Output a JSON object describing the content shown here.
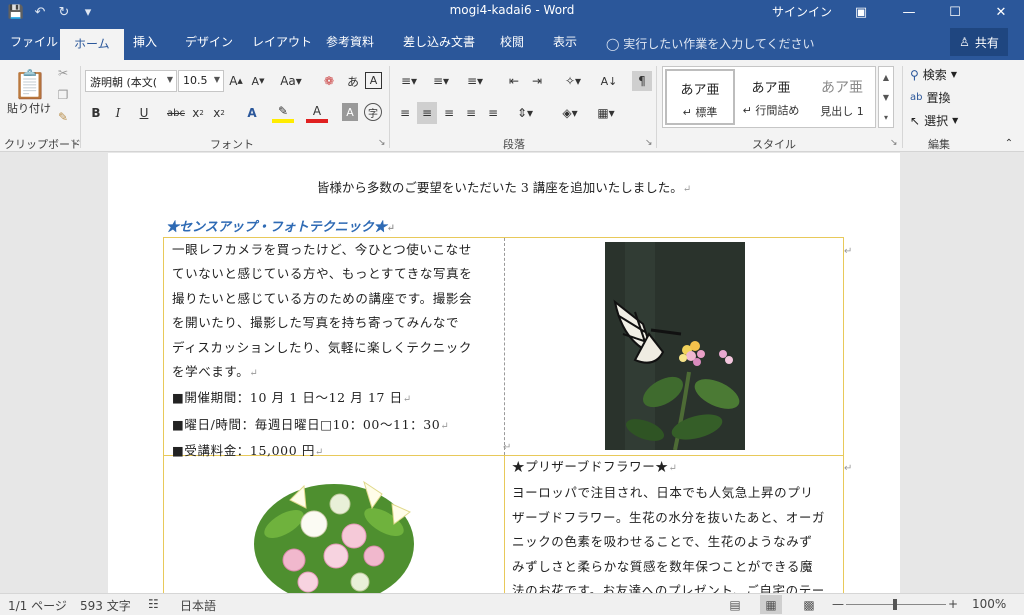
{
  "titlebar": {
    "title": "mogi4-kadai6  -  Word",
    "signin": "サインイン",
    "save_icon": "save-icon",
    "undo_icon": "undo-icon",
    "redo_icon": "redo-icon",
    "customize_icon": "customize-icon"
  },
  "tabs": [
    {
      "label": "ファイル"
    },
    {
      "label": "ホーム"
    },
    {
      "label": "挿入"
    },
    {
      "label": "デザイン"
    },
    {
      "label": "レイアウト"
    },
    {
      "label": "参考資料"
    },
    {
      "label": "差し込み文書"
    },
    {
      "label": "校閲"
    },
    {
      "label": "表示"
    }
  ],
  "tell_me": "実行したい作業を入力してください",
  "share": "共有",
  "ribbon": {
    "clipboard": {
      "group": "クリップボード",
      "paste": "貼り付け"
    },
    "font": {
      "group": "フォント",
      "font_name": "游明朝 (本文(",
      "font_size": "10.5"
    },
    "paragraph": {
      "group": "段落"
    },
    "styles": {
      "group": "スタイル",
      "items": [
        {
          "preview": "あア亜",
          "name": "↵ 標準"
        },
        {
          "preview": "あア亜",
          "name": "↵ 行間詰め"
        },
        {
          "preview": "あア亜",
          "name": "見出し 1"
        }
      ]
    },
    "editing": {
      "group": "編集",
      "find": "検索",
      "replace": "置換",
      "select": "選択"
    }
  },
  "document": {
    "intro": "皆様から多数のご要望をいただいた 3 講座を追加いたしました。",
    "heading1": "★センスアップ・フォトテクニック★",
    "body1": [
      "一眼レフカメラを買ったけど、今ひとつ使いこなせ",
      "ていないと感じている方や、もっとすてきな写真を",
      "撮りたいと感じている方のための講座です。撮影会",
      "を開いたり、撮影した写真を持ち寄ってみんなで",
      "ディスカッションしたり、気軽に楽しくテクニック",
      "を学べます。"
    ],
    "details1": [
      "■開催期間：10 月 1 日～12 月 17 日",
      "■曜日/時間：毎週日曜日□10：00～11：30",
      "■受講料金：15,000 円"
    ],
    "heading2": "★プリザーブドフラワー★",
    "body2": [
      "ヨーロッパで注目され、日本でも人気急上昇のプリ",
      "ザーブドフラワー。生花の水分を抜いたあと、オーガ",
      "ニックの色素を吸わせることで、生花のようなみず",
      "みずしさと柔らかな質感を数年保つことができる魔",
      "法のお花です。お友達へのプレゼント、ご自宅のテー"
    ]
  },
  "status": {
    "page": "1/1 ページ",
    "words": "593 文字",
    "language": "日本語",
    "zoom": "100%"
  }
}
